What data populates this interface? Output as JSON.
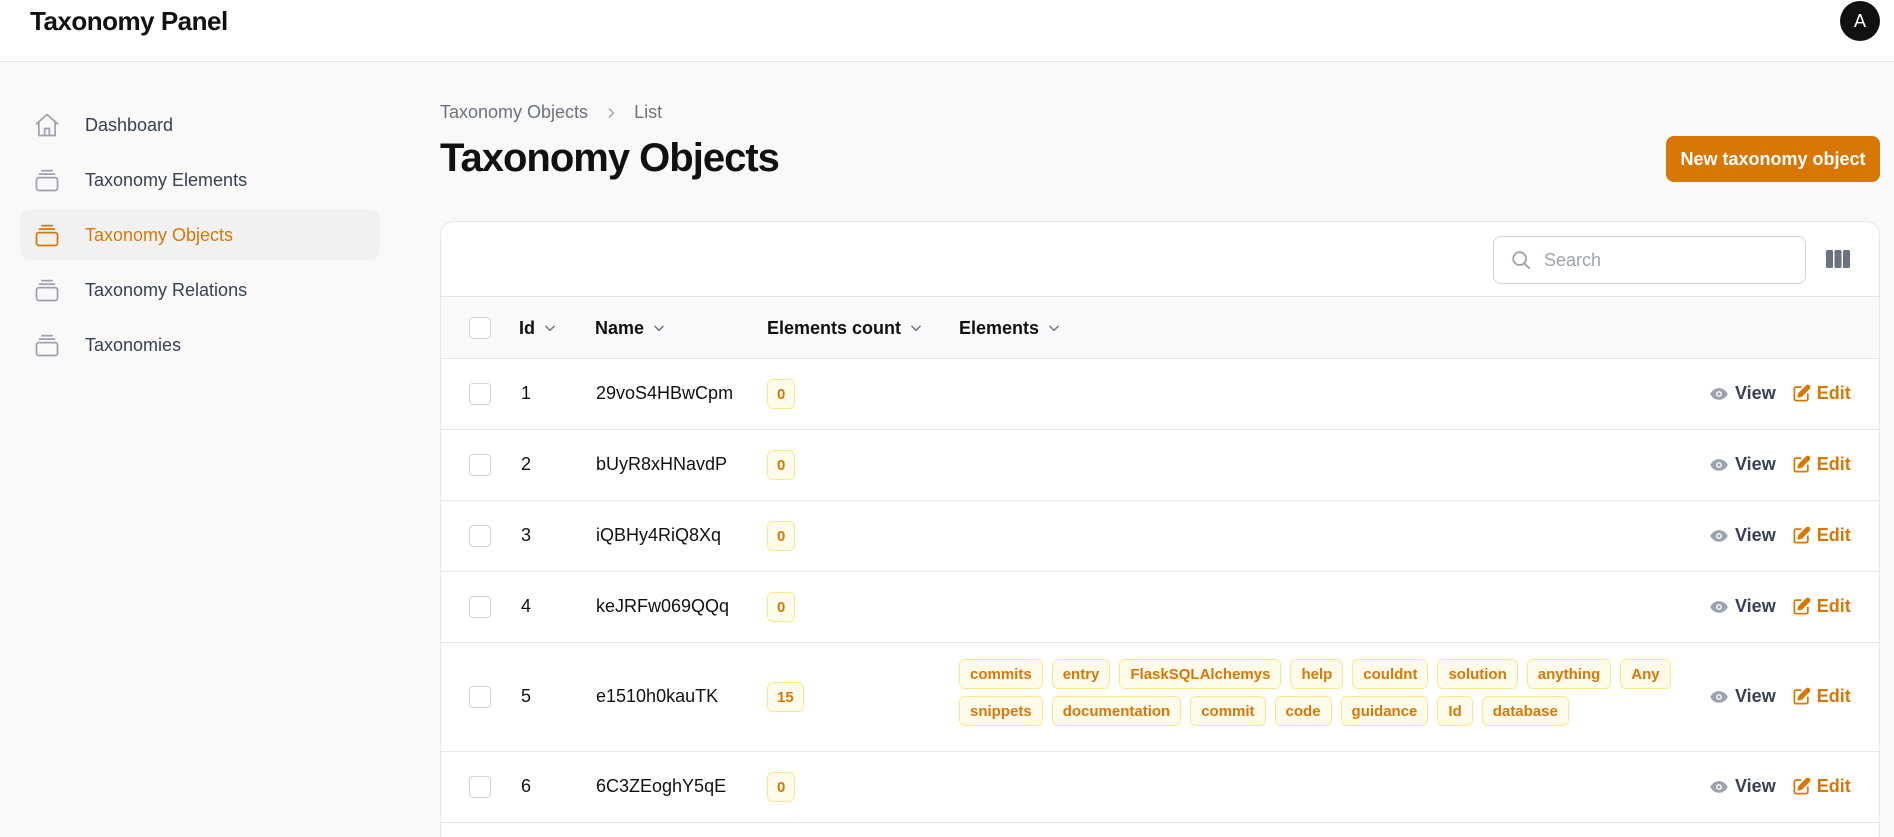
{
  "app": {
    "brand": "Taxonomy Panel",
    "avatar_initial": "A"
  },
  "sidebar": {
    "items": [
      {
        "label": "Dashboard",
        "icon": "home-icon",
        "active": false
      },
      {
        "label": "Taxonomy Elements",
        "icon": "collection-icon",
        "active": false
      },
      {
        "label": "Taxonomy Objects",
        "icon": "collection-icon",
        "active": true
      },
      {
        "label": "Taxonomy Relations",
        "icon": "collection-icon",
        "active": false
      },
      {
        "label": "Taxonomies",
        "icon": "collection-icon",
        "active": false
      }
    ]
  },
  "breadcrumb": {
    "parent": "Taxonomy Objects",
    "current": "List"
  },
  "page": {
    "title": "Taxonomy Objects",
    "new_button": "New taxonomy object"
  },
  "search": {
    "placeholder": "Search"
  },
  "table": {
    "headers": {
      "id": "Id",
      "name": "Name",
      "elements_count": "Elements count",
      "elements": "Elements"
    },
    "rows": [
      {
        "id": "1",
        "name": "29voS4HBwCpm",
        "count": "0",
        "elements": []
      },
      {
        "id": "2",
        "name": "bUyR8xHNavdP",
        "count": "0",
        "elements": []
      },
      {
        "id": "3",
        "name": "iQBHy4RiQ8Xq",
        "count": "0",
        "elements": []
      },
      {
        "id": "4",
        "name": "keJRFw069QQq",
        "count": "0",
        "elements": []
      },
      {
        "id": "5",
        "name": "e1510h0kauTK",
        "count": "15",
        "elements": [
          "commits",
          "entry",
          "FlaskSQLAlchemys",
          "help",
          "couldnt",
          "solution",
          "anything",
          "Any",
          "snippets",
          "documentation",
          "commit",
          "code",
          "guidance",
          "Id",
          "database"
        ]
      },
      {
        "id": "6",
        "name": "6C3ZEoghY5qE",
        "count": "0",
        "elements": []
      }
    ],
    "actions": {
      "view": "View",
      "edit": "Edit"
    }
  },
  "colors": {
    "accent": "#d97706",
    "accent_bg": "#fffbeb",
    "border": "#e5e7eb"
  }
}
